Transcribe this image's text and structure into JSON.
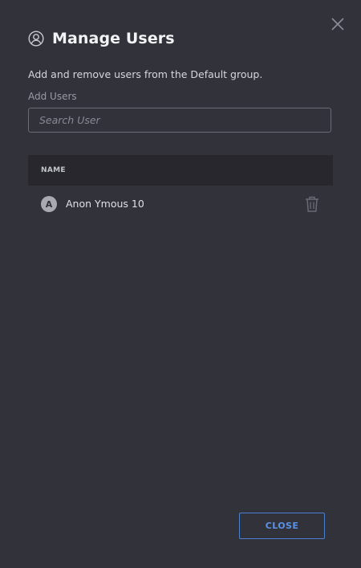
{
  "dialog": {
    "title": "Manage Users",
    "description": "Add and remove users from the Default group.",
    "add_users_label": "Add Users",
    "search_placeholder": "Search User",
    "search_value": ""
  },
  "table": {
    "columns": [
      "NAME"
    ],
    "rows": [
      {
        "avatar_letter": "A",
        "name": "Anon Ymous 10"
      }
    ]
  },
  "footer": {
    "close_label": "CLOSE"
  },
  "icons": {
    "header": "user-circle-icon",
    "dismiss": "close-x-icon",
    "row_action": "trash-icon"
  },
  "colors": {
    "background": "#32323b",
    "table_header": "#27272d",
    "accent": "#5a92e8"
  }
}
